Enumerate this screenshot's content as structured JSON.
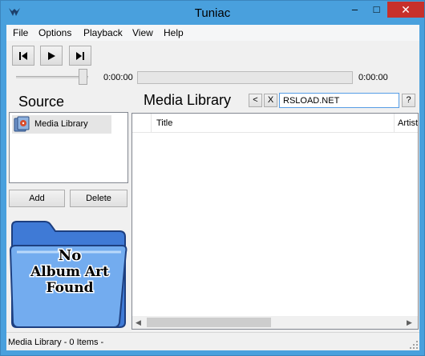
{
  "window": {
    "title": "Tuniac"
  },
  "titlebar_buttons": {
    "minimize": "–",
    "maximize": "□",
    "close": "✕"
  },
  "menu": [
    "File",
    "Options",
    "Playback",
    "View",
    "Help"
  ],
  "transport": {
    "elapsed": "0:00:00",
    "total": "0:00:00"
  },
  "source": {
    "heading": "Source",
    "items": [
      {
        "label": "Media Library",
        "icon": "media-library-icon"
      }
    ],
    "add_label": "Add",
    "delete_label": "Delete"
  },
  "album_art": {
    "line1": "No",
    "line2": "Album Art",
    "line3": "Found"
  },
  "library": {
    "heading": "Media Library",
    "back_label": "<",
    "clear_label": "X",
    "search_value": "RSLOAD.NET",
    "help_label": "?",
    "columns": [
      "Title",
      "Artist"
    ]
  },
  "status": {
    "text": "Media Library - 0 Items -"
  },
  "colors": {
    "titlebar": "#49a0dd",
    "close_button": "#c7302a",
    "search_border": "#569de5"
  }
}
